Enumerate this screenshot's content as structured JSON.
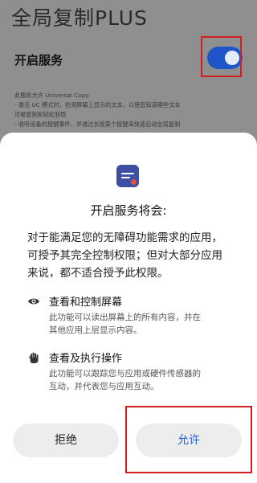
{
  "settings": {
    "app_title": "全局复制PLUS",
    "service_label": "开启服务",
    "service_enabled": true,
    "description_lines": [
      "此服务允许 Universal Copy:",
      "- 激活 UC 模式时，检测屏幕上显示的文本，以使您知道哪些文本",
      "可被复制和轻松获取",
      "- 收听设备的按键事件，并通过长按某个按键来快速启动全局复制"
    ]
  },
  "dialog": {
    "icon": "app-icon",
    "title": "开启服务将会:",
    "intro_lines": [
      "对于能满足您的无障碍功能需求的应用，",
      "可授予其完全控制权限；但对大部分应用",
      "来说，都不适合授予此权限。"
    ],
    "permissions": [
      {
        "icon": "eye-icon",
        "title": "查看和控制屏幕",
        "desc_lines": [
          "此功能可以读出屏幕上的所有内容，并在",
          "其他应用上层显示内容。"
        ]
      },
      {
        "icon": "hand-icon",
        "title": "查看及执行操作",
        "desc_lines": [
          "此功能可以跟踪您与应用或硬件传感器的",
          "互动，并代表您与应用互动。"
        ]
      }
    ],
    "deny_label": "拒绝",
    "allow_label": "允许"
  },
  "colors": {
    "accent": "#1e56c9",
    "allow_text": "#1c5fd6",
    "highlight": "#d41e1e"
  }
}
